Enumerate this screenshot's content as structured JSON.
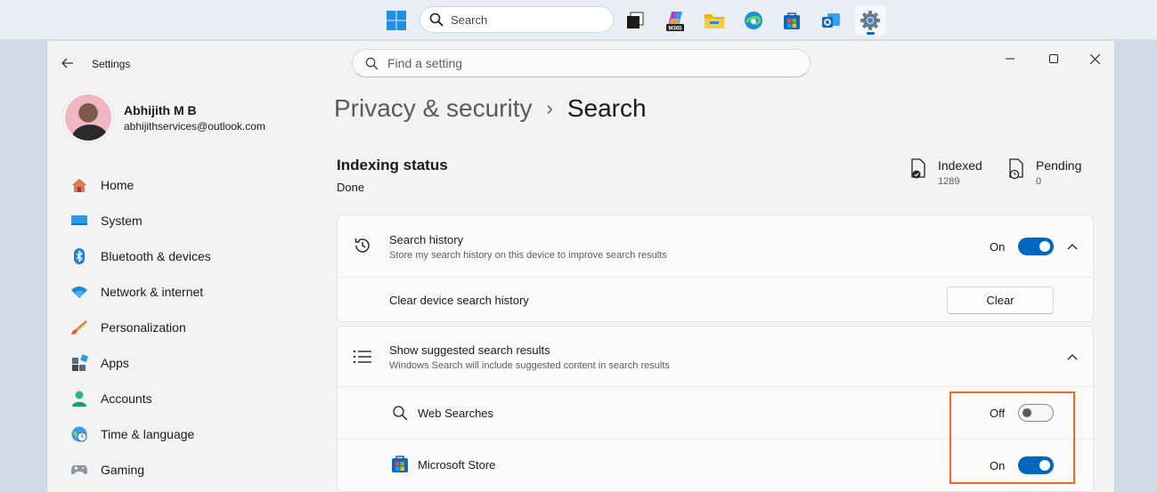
{
  "taskbar": {
    "search_label": "Search",
    "apps": [
      {
        "icon": "task-view-icon"
      },
      {
        "icon": "m365-icon",
        "badge": "M365"
      },
      {
        "icon": "file-explorer-icon"
      },
      {
        "icon": "edge-icon"
      },
      {
        "icon": "microsoft-store-icon"
      },
      {
        "icon": "outlook-icon"
      },
      {
        "icon": "settings-app-icon"
      }
    ]
  },
  "window": {
    "app_title": "Settings",
    "search_placeholder": "Find a setting"
  },
  "profile": {
    "name": "Abhijith M B",
    "email": "abhijithservices@outlook.com"
  },
  "sidebar": {
    "items": [
      {
        "label": "Home",
        "icon": "home-icon"
      },
      {
        "label": "System",
        "icon": "system-icon"
      },
      {
        "label": "Bluetooth & devices",
        "icon": "bluetooth-icon"
      },
      {
        "label": "Network & internet",
        "icon": "network-icon"
      },
      {
        "label": "Personalization",
        "icon": "brush-icon"
      },
      {
        "label": "Apps",
        "icon": "apps-icon"
      },
      {
        "label": "Accounts",
        "icon": "accounts-icon"
      },
      {
        "label": "Time & language",
        "icon": "time-language-icon"
      },
      {
        "label": "Gaming",
        "icon": "gaming-icon"
      }
    ]
  },
  "main": {
    "breadcrumb_parent": "Privacy & security",
    "breadcrumb_separator": "›",
    "page_title": "Search",
    "indexing": {
      "title": "Indexing status",
      "status": "Done",
      "indexed_label": "Indexed",
      "indexed_count": "1289",
      "pending_label": "Pending",
      "pending_count": "0"
    },
    "search_history": {
      "title": "Search history",
      "description": "Store my search history on this device to improve search results",
      "toggle_state": "On",
      "clear_row_label": "Clear device search history",
      "clear_button": "Clear"
    },
    "suggested_results": {
      "title": "Show suggested search results",
      "description": "Windows Search will include suggested content in search results",
      "web_searches_label": "Web Searches",
      "web_searches_state": "Off",
      "store_label": "Microsoft Store",
      "store_state": "On"
    }
  },
  "colors": {
    "accent": "#0067c0",
    "highlight": "#f06a1d"
  }
}
